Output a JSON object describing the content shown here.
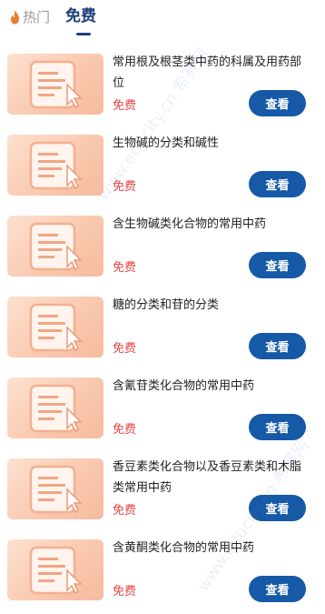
{
  "tabs": {
    "hot_label": "热门",
    "free_label": "免费"
  },
  "colors": {
    "accent": "#1659a6",
    "price": "#e64545",
    "active_tab": "#1d3f7a",
    "flame": "#f07a2a"
  },
  "courses": [
    {
      "title": "常用根及根茎类中药的科属及用药部位",
      "price": "免费",
      "button": "查看",
      "thumb_icon": "document-cursor-icon"
    },
    {
      "title": "生物碱的分类和碱性",
      "price": "免费",
      "button": "查看",
      "thumb_icon": "document-cursor-icon"
    },
    {
      "title": "含生物碱类化合物的常用中药",
      "price": "免费",
      "button": "查看",
      "thumb_icon": "document-cursor-icon"
    },
    {
      "title": "糖的分类和苷的分类",
      "price": "免费",
      "button": "查看",
      "thumb_icon": "document-cursor-icon"
    },
    {
      "title": "含氰苷类化合物的常用中药",
      "price": "免费",
      "button": "查看",
      "thumb_icon": "document-cursor-icon"
    },
    {
      "title": "香豆素类化合物以及香豆素类和木脂类常用中药",
      "price": "免费",
      "button": "查看",
      "thumb_icon": "document-cursor-icon"
    },
    {
      "title": "含黄酮类化合物的常用中药",
      "price": "免费",
      "button": "查看",
      "thumb_icon": "document-cursor-icon"
    }
  ],
  "watermark": "www.educity.cn 希赛网"
}
